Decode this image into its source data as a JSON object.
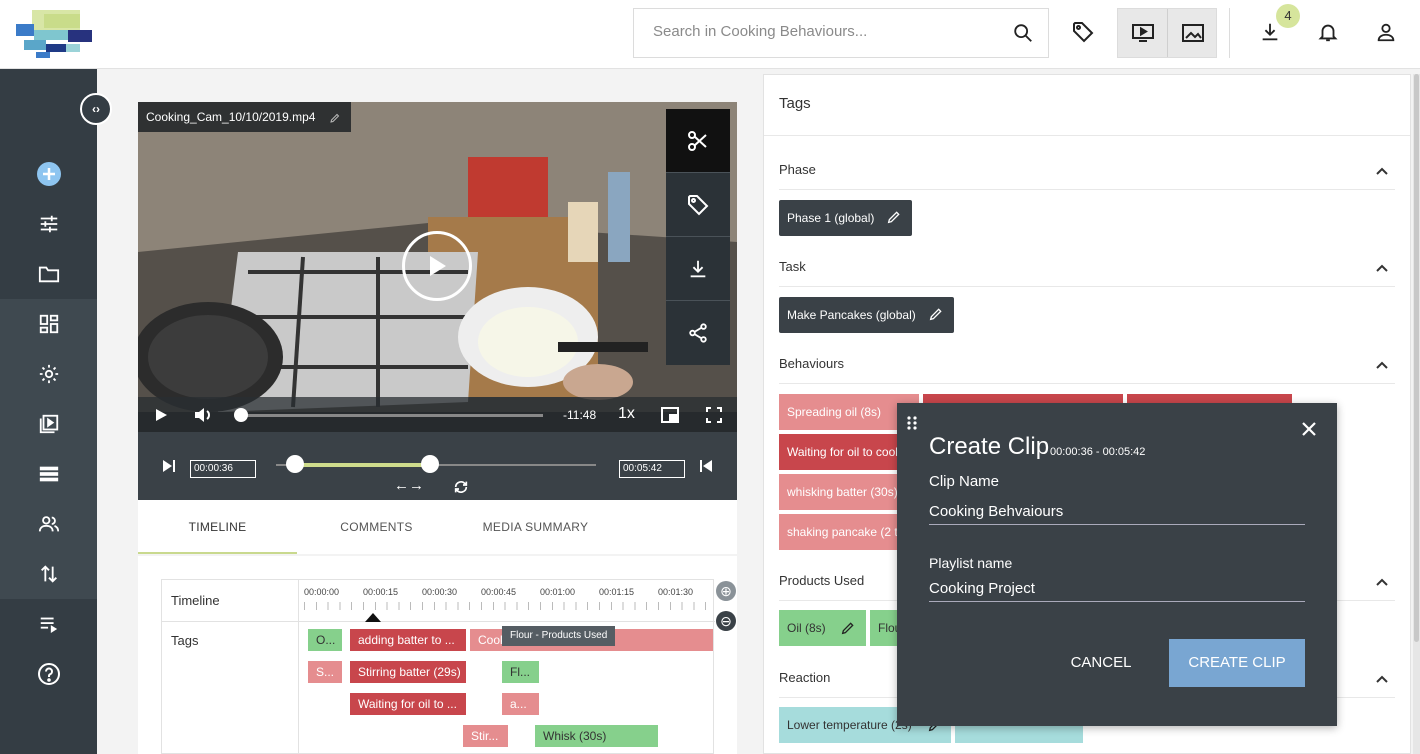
{
  "header": {
    "search_placeholder": "Search in Cooking Behaviours...",
    "download_count": "4"
  },
  "video": {
    "title": "Cooking_Cam_10/10/2019.mp4",
    "remaining": "-11:48",
    "speed": "1x",
    "playback_progress": 0.0,
    "clip_start": "00:00:36",
    "clip_end": "00:05:42"
  },
  "tabs": {
    "timeline": "TIMELINE",
    "comments": "COMMENTS",
    "summary": "MEDIA SUMMARY"
  },
  "timeline": {
    "row_timeline": "Timeline",
    "row_tags": "Tags",
    "ticks": [
      "00:00:00",
      "00:00:15",
      "00:00:30",
      "00:00:45",
      "00:01:00",
      "00:01:15",
      "00:01:30"
    ],
    "tooltip": "Flour - Products Used",
    "chips": {
      "c1": "O...",
      "c2": "adding batter to ...",
      "c3": "Cook",
      "c4": "S...",
      "c5": "Stirring batter (29s)",
      "c6": "Fl...",
      "c7": "Waiting for oil to ...",
      "c8": "a...",
      "c9": "Stir...",
      "c10": "Whisk (30s)"
    }
  },
  "tags": {
    "title": "Tags",
    "phase": {
      "label": "Phase",
      "tag": "Phase 1 (global)"
    },
    "task": {
      "label": "Task",
      "tag": "Make Pancakes (global)"
    },
    "behaviours": {
      "label": "Behaviours",
      "items": [
        "Spreading oil (8s)",
        "Waiting for oil to cook",
        "whisking batter (30s)",
        "shaking pancake (2 ta"
      ]
    },
    "products": {
      "label": "Products Used",
      "items": [
        "Oil (8s)",
        "Flou"
      ]
    },
    "reaction": {
      "label": "Reaction",
      "items": [
        "Lower temperature (2s)"
      ]
    }
  },
  "modal": {
    "title": "Create Clip",
    "range": "00:00:36 - 00:05:42",
    "clip_name_label": "Clip Name",
    "clip_name_value": "Cooking Behvaiours",
    "playlist_label": "Playlist name",
    "playlist_value": "Cooking Project",
    "cancel": "CANCEL",
    "create": "CREATE CLIP"
  }
}
